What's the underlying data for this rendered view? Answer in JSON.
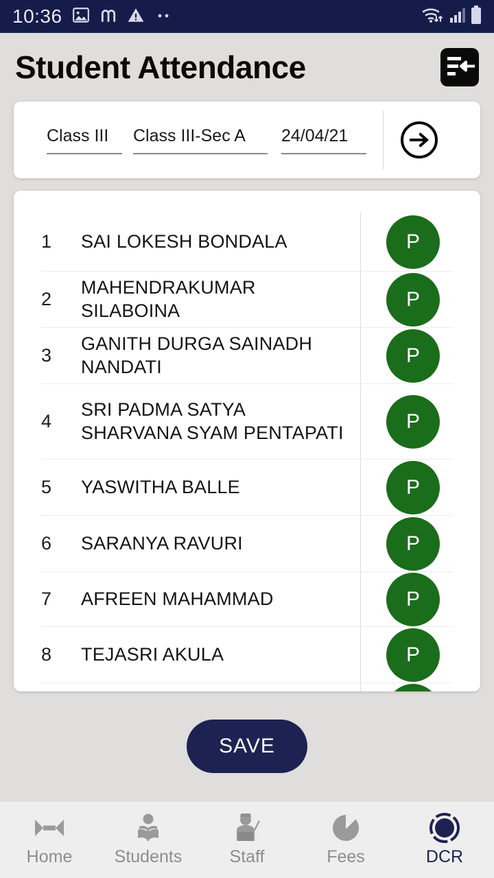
{
  "statusbar": {
    "time": "10:36",
    "left_icons": [
      "image-icon",
      "m-glyph-icon",
      "warning-icon",
      "more-dots-icon"
    ],
    "right_icons": [
      "wifi-icon",
      "signal-icon",
      "battery-icon"
    ],
    "background": "#161c4a",
    "foreground": "#e8e9f5"
  },
  "header": {
    "title": "Student Attendance",
    "action_icon": "import-list-icon"
  },
  "selector": {
    "class_value": "Class III",
    "section_value": "Class III-Sec A",
    "date_value": "24/04/21",
    "go_icon": "arrow-right-circle-icon"
  },
  "list": {
    "rows": [
      {
        "num": "1",
        "name": "SAI LOKESH  BONDALA",
        "status": "P"
      },
      {
        "num": "2",
        "name": "MAHENDRAKUMAR SILABOINA",
        "status": "P"
      },
      {
        "num": "3",
        "name": "GANITH DURGA SAINADH NANDATI",
        "status": "P"
      },
      {
        "num": "4",
        "name": "SRI PADMA SATYA SHARVANA SYAM PENTAPATI",
        "status": "P"
      },
      {
        "num": "5",
        "name": "YASWITHA  BALLE",
        "status": "P"
      },
      {
        "num": "6",
        "name": "SARANYA  RAVURI",
        "status": "P"
      },
      {
        "num": "7",
        "name": "AFREEN  MAHAMMAD",
        "status": "P"
      },
      {
        "num": "8",
        "name": "TEJASRI  AKULA",
        "status": "P"
      }
    ],
    "present_color": "#1a6d1a"
  },
  "actions": {
    "save_label": "SAVE",
    "save_color": "#1e2252"
  },
  "bottomnav": {
    "items": [
      {
        "label": "Home",
        "icon": "home-bowtie-icon",
        "active": false
      },
      {
        "label": "Students",
        "icon": "student-book-icon",
        "active": false
      },
      {
        "label": "Staff",
        "icon": "teacher-icon",
        "active": false
      },
      {
        "label": "Fees",
        "icon": "pie-chart-icon",
        "active": false
      },
      {
        "label": "DCR",
        "icon": "dcr-circle-icon",
        "active": true
      }
    ],
    "active_color": "#1e2252",
    "inactive_color": "#8d8d8d"
  }
}
